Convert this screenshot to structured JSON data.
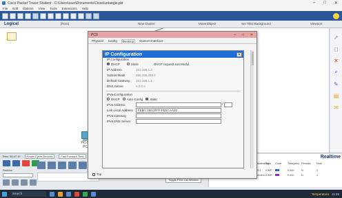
{
  "window": {
    "title": "Cisco Packet Tracer Student - C:\\Users\\user\\Documents\\Cisco\\untangle.pkt",
    "controls": {
      "minimize": "–",
      "maximize": "□",
      "close": "✕"
    }
  },
  "menu": {
    "items": [
      "File",
      "Edit",
      "Options",
      "View",
      "Tools",
      "Extensions",
      "Help"
    ]
  },
  "workspace": {
    "logical": "Logical",
    "root": "[Root]",
    "new_cluster": "New Cluster",
    "move_object": "Move Object",
    "set_tiled_bg": "Set Tiled Background",
    "viewport": "Viewport"
  },
  "canvas": {
    "pc_label_type": "PC-PT",
    "pc_label_name": "PC0",
    "partial_node": "Sw"
  },
  "bottom": {
    "time": "Time: 00:47:19",
    "power_cycle": "Power Cycle Devices",
    "fast_forward": "Fast Forward Time",
    "router_label": "Routers",
    "new_btn": "New",
    "delete_btn": "Delete",
    "toggle_pdu": "Toggle PDU List Window",
    "realtime": "Realtime",
    "pdu_headers": [
      "Fire",
      "Last Status",
      "Source",
      "Destination",
      "Type",
      "Color",
      "Time(sec)",
      "Periodic",
      "Num"
    ],
    "pdu_rows": [
      {
        "fire": "",
        "status": "Successful",
        "source": "PC1",
        "dest": "PC1",
        "type": "ICMP",
        "time": "0.000",
        "periodic": "N",
        "num": "0",
        "color": "#2a6ad4"
      },
      {
        "fire": "",
        "status": "Successful",
        "source": "PC0",
        "dest": "Server0",
        "type": "ICMP",
        "time": "0.000",
        "periodic": "N",
        "num": "1",
        "color": "#8a2ad4"
      }
    ]
  },
  "dialog": {
    "title": "PC0",
    "tabs": [
      "Physical",
      "Config",
      "Desktop",
      "Custom Interface"
    ],
    "active_tab": "Desktop",
    "ipconfig": {
      "title": "IP Configuration",
      "ipv4_section": "IP Configuration",
      "dhcp_label": "DHCP",
      "static_label": "Static",
      "status_message": "DHCP request successful.",
      "fields": [
        {
          "label": "IP Address",
          "value": "192.168.1.3"
        },
        {
          "label": "Subnet Mask",
          "value": "255.255.255.0"
        },
        {
          "label": "Default Gateway",
          "value": "192.168.1.1"
        },
        {
          "label": "DNS Server",
          "value": "0.0.0.0"
        }
      ],
      "ipv6_section": "IPv6 Configuration",
      "ipv6_dhcp": "DHCP",
      "ipv6_auto": "Auto Config",
      "ipv6_static": "Static",
      "ipv6_fields": [
        {
          "label": "IPv6 Address",
          "value": ""
        },
        {
          "label": "Link Local Address",
          "value": "FE80::260:2FFF:FE57:AA20"
        },
        {
          "label": "IPv6 Gateway",
          "value": ""
        },
        {
          "label": "IPv6 DNS Server",
          "value": ""
        }
      ]
    },
    "top_checkbox": "Top"
  },
  "taskbar": {
    "search_placeholder": "Search",
    "weather": "Temperatura",
    "time": "11:26"
  }
}
